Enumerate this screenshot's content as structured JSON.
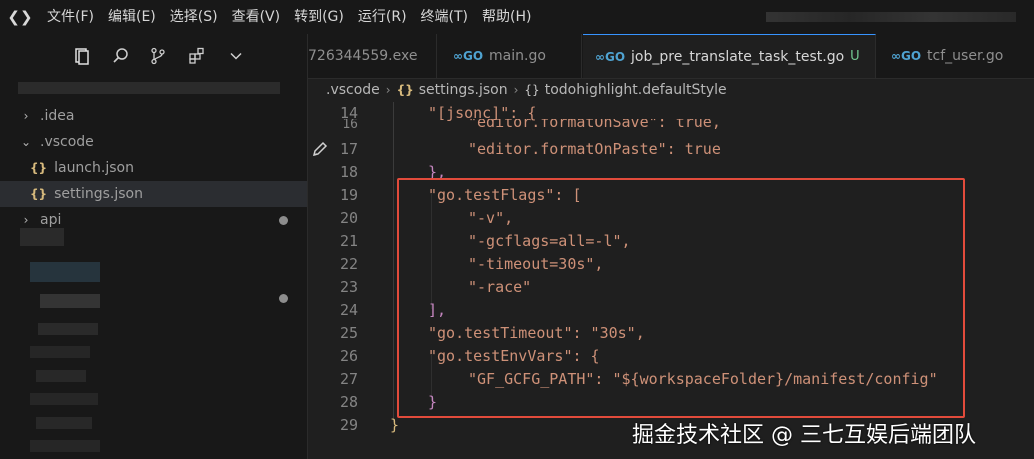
{
  "menu": [
    "文件(F)",
    "编辑(E)",
    "选择(S)",
    "查看(V)",
    "转到(G)",
    "运行(R)",
    "终端(T)",
    "帮助(H)"
  ],
  "tabs": [
    {
      "label": "726344559.exe",
      "active": false
    },
    {
      "label": "main.go",
      "active": false
    },
    {
      "label": "job_pre_translate_task_test.go",
      "active": true,
      "badge": "U"
    },
    {
      "label": "tcf_user.go",
      "active": false
    }
  ],
  "breadcrumb": {
    "folder": ".vscode",
    "file": "settings.json",
    "symbol": "todohighlight.defaultStyle"
  },
  "sidebar": {
    "items": [
      {
        "label": ".idea",
        "chevron": "›"
      },
      {
        "label": ".vscode",
        "chevron": "⌄"
      },
      {
        "label": "launch.json",
        "chevron": ""
      },
      {
        "label": "settings.json",
        "chevron": ""
      },
      {
        "label": "api",
        "chevron": "›"
      }
    ]
  },
  "editor": {
    "lines": [
      {
        "num": "14",
        "text": "\"[jsonc]\": {"
      },
      {
        "num": "16",
        "text": "\"editor.formatOnSave\": true,"
      },
      {
        "num": "17",
        "text": "\"editor.formatOnPaste\": true"
      },
      {
        "num": "18",
        "text": "},"
      },
      {
        "num": "19",
        "text": "\"go.testFlags\": ["
      },
      {
        "num": "20",
        "text": "\"-v\","
      },
      {
        "num": "21",
        "text": "\"-gcflags=all=-l\","
      },
      {
        "num": "22",
        "text": "\"-timeout=30s\","
      },
      {
        "num": "23",
        "text": "\"-race\""
      },
      {
        "num": "24",
        "text": "],"
      },
      {
        "num": "25",
        "text": "\"go.testTimeout\": \"30s\","
      },
      {
        "num": "26",
        "text": "\"go.testEnvVars\": {"
      },
      {
        "num": "27",
        "text": "\"GF_GCFG_PATH\": \"${workspaceFolder}/manifest/config\""
      },
      {
        "num": "28",
        "text": "}"
      },
      {
        "num": "29",
        "text": "}"
      }
    ]
  },
  "watermark": "掘金技术社区 @ 三七互娱后端团队",
  "colors": {
    "accent_box": "#e24b3b",
    "string": "#ce9178",
    "bracket": "#c586c0"
  }
}
